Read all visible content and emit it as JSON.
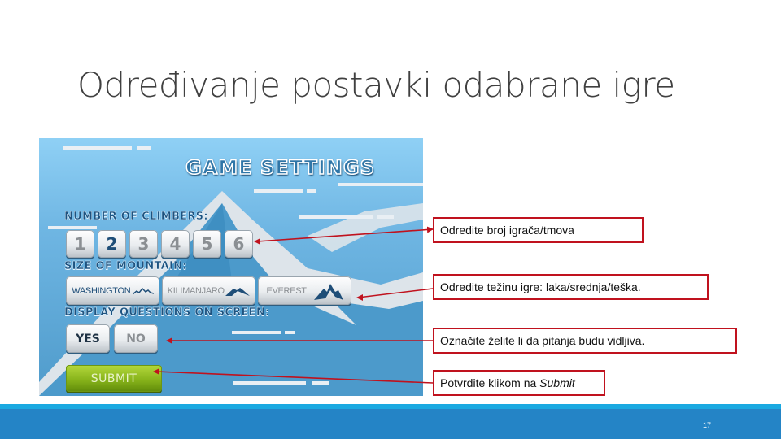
{
  "slide": {
    "title": "Određivanje postavki odabrane igre",
    "page_number": "17"
  },
  "game": {
    "title": "GAME SETTINGS",
    "climbers_label": "NUMBER OF CLIMBERS:",
    "climbers": [
      {
        "label": "1",
        "selected": false
      },
      {
        "label": "2",
        "selected": true
      },
      {
        "label": "3",
        "selected": false
      },
      {
        "label": "4",
        "selected": false
      },
      {
        "label": "5",
        "selected": false
      },
      {
        "label": "6",
        "selected": false
      }
    ],
    "mountain_label": "SIZE OF MOUNTAIN:",
    "mountains": [
      {
        "label": "WASHINGTON",
        "icon": "small-mountain-icon",
        "selected": true
      },
      {
        "label": "KILIMANJARO",
        "icon": "medium-mountain-icon",
        "selected": false
      },
      {
        "label": "EVEREST",
        "icon": "tall-mountain-icon",
        "selected": false
      }
    ],
    "questions_label": "DISPLAY QUESTIONS ON SCREEN:",
    "questions": [
      {
        "label": "YES",
        "selected": true
      },
      {
        "label": "NO",
        "selected": false
      }
    ],
    "submit_label": "SUBMIT"
  },
  "callouts": [
    {
      "text": "Odredite broj igrača/tmova"
    },
    {
      "text": "Odredite težinu igre: laka/srednja/teška."
    },
    {
      "text": "Označite želite li da pitanja budu vidljiva."
    },
    {
      "text_prefix": "Potvrdite klikom na ",
      "text_emphasis": "Submit"
    }
  ],
  "colors": {
    "callout_border": "#c0121e",
    "arrow": "#c0121e",
    "footer": "#2484c6",
    "footer_strip": "#1aa9e1",
    "selected_text": "#1f4e78",
    "submit_green": "#88b41b"
  }
}
